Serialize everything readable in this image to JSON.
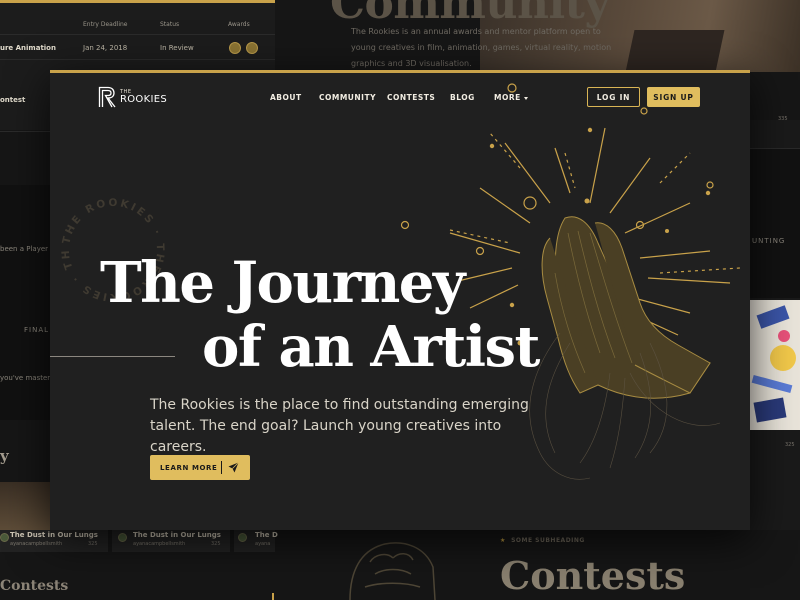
{
  "background": {
    "table": {
      "headers": [
        "Entry Deadline",
        "Status",
        "Awards"
      ],
      "rows": [
        {
          "name": "ure Animation",
          "deadline": "Jan 24, 2018",
          "status": "In Review"
        },
        {
          "name": "ontest",
          "deadline": "",
          "status": ""
        }
      ]
    },
    "community_title": "Community",
    "community_text": "The Rookies is an annual awards and mentor platform open to young creatives in film, animation, games, virtual reality, motion graphics and 3D visualisation.",
    "left_snippets": [
      "been a Player f",
      "FINAL",
      "you've mastered"
    ],
    "left_heading": "y",
    "contests_small": "Contests",
    "cards": [
      {
        "title": "The Dust in Our Lungs",
        "user": "ayanacampbellsmith",
        "count": "325"
      },
      {
        "title": "The Dust in Our Lungs",
        "user": "ayanacampbellsmith",
        "count": "325"
      },
      {
        "title": "The D",
        "user": "ayana",
        "count": ""
      }
    ],
    "right_label": "UNTING",
    "right_counts": [
      "335",
      "325",
      "325"
    ],
    "subheading": "SOME SUBHEADING",
    "contests_big": "Contests"
  },
  "header": {
    "logo_the": "THE",
    "logo_name": "ROOKIES",
    "nav": [
      "ABOUT",
      "COMMUNITY",
      "CONTESTS",
      "BLOG",
      "MORE"
    ],
    "login": "LOG IN",
    "signup": "SIGN UP"
  },
  "hero": {
    "circle_text": "THE ROOKIES · THE ROOKIES · THE ROOKIES ·",
    "title_line1": "The Journey",
    "title_line2": "of an Artist",
    "subtitle": "The Rookies is the place to find outstanding emerging talent. The end goal? Launch young creatives into careers.",
    "cta": "LEARN MORE"
  },
  "colors": {
    "accent": "#e0bd5e",
    "background": "#202020",
    "text": "#ffffff"
  },
  "icons": [
    "rookies-logo-icon",
    "chevron-down-icon",
    "paper-plane-icon",
    "clapping-hands-illustration"
  ]
}
